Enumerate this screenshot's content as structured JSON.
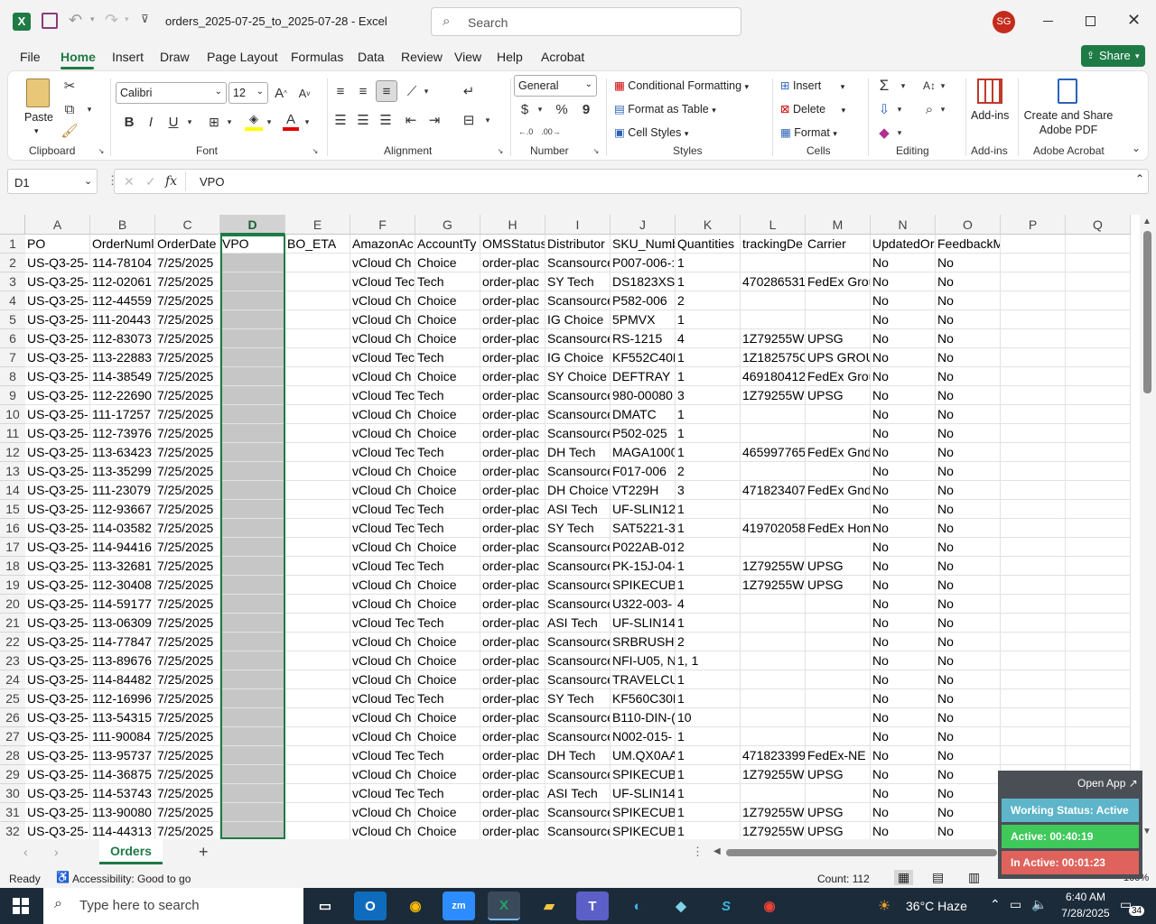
{
  "window": {
    "title": "orders_2025-07-25_to_2025-07-28  -  Excel",
    "search_placeholder": "Search",
    "user_initials": "SG"
  },
  "tabs": [
    "File",
    "Home",
    "Insert",
    "Draw",
    "Page Layout",
    "Formulas",
    "Data",
    "Review",
    "View",
    "Help",
    "Acrobat"
  ],
  "share_label": "Share",
  "ribbon": {
    "clipboard": {
      "paste": "Paste",
      "label": "Clipboard"
    },
    "font": {
      "name": "Calibri",
      "size": "12",
      "label": "Font"
    },
    "alignment": {
      "label": "Alignment"
    },
    "number": {
      "format": "General",
      "label": "Number"
    },
    "styles": {
      "conditional": "Conditional Formatting",
      "format_table": "Format as Table",
      "cell_styles": "Cell Styles",
      "label": "Styles"
    },
    "cells": {
      "insert": "Insert",
      "delete": "Delete",
      "format": "Format",
      "label": "Cells"
    },
    "editing": {
      "label": "Editing"
    },
    "addins": {
      "button": "Add-ins",
      "label": "Add-ins"
    },
    "acrobat": {
      "button_line1": "Create and Share",
      "button_line2": "Adobe PDF",
      "label": "Adobe Acrobat"
    }
  },
  "formula_bar": {
    "name_box": "D1",
    "fx": "fx",
    "value": "VPO"
  },
  "columns": [
    "A",
    "B",
    "C",
    "D",
    "E",
    "F",
    "G",
    "H",
    "I",
    "J",
    "K",
    "L",
    "M",
    "N",
    "O",
    "P",
    "Q"
  ],
  "rows": [
    [
      "PO",
      "OrderNuml",
      "OrderDate",
      "VPO",
      "BO_ETA",
      "AmazonAc",
      "AccountTy",
      "OMSStatus",
      "Distributor",
      "SKU_Numb",
      "Quantities",
      "trackingDe",
      "Carrier",
      "UpdatedOr",
      "FeedbackMessage",
      "",
      ""
    ],
    [
      "US-Q3-25-",
      "114-78104",
      "7/25/2025",
      "",
      "",
      "vCloud Ch",
      "Choice",
      "order-plac",
      "Scansource",
      "P007-006-:",
      "1",
      "",
      "",
      "No",
      "No",
      "",
      ""
    ],
    [
      "US-Q3-25-",
      "112-02061",
      "7/25/2025",
      "",
      "",
      "vCloud Tec",
      "Tech",
      "order-plac",
      "SY Tech",
      "DS1823XS+",
      "1",
      "470286531",
      "FedEx Grou",
      "No",
      "No",
      "",
      ""
    ],
    [
      "US-Q3-25-",
      "112-44559",
      "7/25/2025",
      "",
      "",
      "vCloud Ch",
      "Choice",
      "order-plac",
      "Scansource",
      "P582-006",
      "2",
      "",
      "",
      "No",
      "No",
      "",
      ""
    ],
    [
      "US-Q3-25-",
      "111-20443",
      "7/25/2025",
      "",
      "",
      "vCloud Ch",
      "Choice",
      "order-plac",
      "IG Choice",
      "5PMVX",
      "1",
      "",
      "",
      "No",
      "No",
      "",
      ""
    ],
    [
      "US-Q3-25-",
      "112-83073",
      "7/25/2025",
      "",
      "",
      "vCloud Ch",
      "Choice",
      "order-plac",
      "Scansource",
      "RS-1215",
      "4",
      "1Z79255W",
      "UPSG",
      "No",
      "No",
      "",
      ""
    ],
    [
      "US-Q3-25-",
      "113-22883",
      "7/25/2025",
      "",
      "",
      "vCloud Tec",
      "Tech",
      "order-plac",
      "IG Choice",
      "KF552C40E",
      "1",
      "1Z182575C",
      "UPS GROU",
      "No",
      "No",
      "",
      ""
    ],
    [
      "US-Q3-25-",
      "114-38549",
      "7/25/2025",
      "",
      "",
      "vCloud Ch",
      "Choice",
      "order-plac",
      "SY Choice",
      "DEFTRAY",
      "1",
      "469180412",
      "FedEx Grou",
      "No",
      "No",
      "",
      ""
    ],
    [
      "US-Q3-25-",
      "112-22690",
      "7/25/2025",
      "",
      "",
      "vCloud Tec",
      "Tech",
      "order-plac",
      "Scansource",
      "980-00080",
      "3",
      "1Z79255W",
      "UPSG",
      "No",
      "No",
      "",
      ""
    ],
    [
      "US-Q3-25-",
      "111-17257",
      "7/25/2025",
      "",
      "",
      "vCloud Ch",
      "Choice",
      "order-plac",
      "Scansource",
      "DMATC",
      "1",
      "",
      "",
      "No",
      "No",
      "",
      ""
    ],
    [
      "US-Q3-25-",
      "112-73976",
      "7/25/2025",
      "",
      "",
      "vCloud Ch",
      "Choice",
      "order-plac",
      "Scansource",
      "P502-025",
      "1",
      "",
      "",
      "No",
      "No",
      "",
      ""
    ],
    [
      "US-Q3-25-",
      "113-63423",
      "7/25/2025",
      "",
      "",
      "vCloud Tec",
      "Tech",
      "order-plac",
      "DH Tech",
      "MAGA1000",
      "1",
      "465997765",
      "FedEx Gnd",
      "No",
      "No",
      "",
      ""
    ],
    [
      "US-Q3-25-",
      "113-35299",
      "7/25/2025",
      "",
      "",
      "vCloud Ch",
      "Choice",
      "order-plac",
      "Scansource",
      "F017-006",
      "2",
      "",
      "",
      "No",
      "No",
      "",
      ""
    ],
    [
      "US-Q3-25-",
      "111-23079",
      "7/25/2025",
      "",
      "",
      "vCloud Ch",
      "Choice",
      "order-plac",
      "DH Choice",
      "VT229H",
      "3",
      "471823407",
      "FedEx Gnd",
      "No",
      "No",
      "",
      ""
    ],
    [
      "US-Q3-25-",
      "112-93667",
      "7/25/2025",
      "",
      "",
      "vCloud Tec",
      "Tech",
      "order-plac",
      "ASI Tech",
      "UF-SLIN12(",
      "1",
      "",
      "",
      "No",
      "No",
      "",
      ""
    ],
    [
      "US-Q3-25-",
      "114-03582",
      "7/25/2025",
      "",
      "",
      "vCloud Tec",
      "Tech",
      "order-plac",
      "SY Tech",
      "SAT5221-3",
      "1",
      "419702058",
      "FedEx Hon",
      "No",
      "No",
      "",
      ""
    ],
    [
      "US-Q3-25-",
      "114-94416",
      "7/25/2025",
      "",
      "",
      "vCloud Ch",
      "Choice",
      "order-plac",
      "Scansource",
      "P022AB-01",
      "2",
      "",
      "",
      "No",
      "No",
      "",
      ""
    ],
    [
      "US-Q3-25-",
      "113-32681",
      "7/25/2025",
      "",
      "",
      "vCloud Tec",
      "Tech",
      "order-plac",
      "Scansource",
      "PK-15J-04-",
      "1",
      "1Z79255W",
      "UPSG",
      "No",
      "No",
      "",
      ""
    ],
    [
      "US-Q3-25-",
      "112-30408",
      "7/25/2025",
      "",
      "",
      "vCloud Ch",
      "Choice",
      "order-plac",
      "Scansource",
      "SPIKECUBE",
      "1",
      "1Z79255W",
      "UPSG",
      "No",
      "No",
      "",
      ""
    ],
    [
      "US-Q3-25-",
      "114-59177",
      "7/25/2025",
      "",
      "",
      "vCloud Ch",
      "Choice",
      "order-plac",
      "Scansource",
      "U322-003-",
      "4",
      "",
      "",
      "No",
      "No",
      "",
      ""
    ],
    [
      "US-Q3-25-",
      "113-06309",
      "7/25/2025",
      "",
      "",
      "vCloud Tec",
      "Tech",
      "order-plac",
      "ASI Tech",
      "UF-SLIN14(",
      "1",
      "",
      "",
      "No",
      "No",
      "",
      ""
    ],
    [
      "US-Q3-25-",
      "114-77847",
      "7/25/2025",
      "",
      "",
      "vCloud Ch",
      "Choice",
      "order-plac",
      "Scansource",
      "SRBRUSHV",
      "2",
      "",
      "",
      "No",
      "No",
      "",
      ""
    ],
    [
      "US-Q3-25-",
      "113-89676",
      "7/25/2025",
      "",
      "",
      "vCloud Ch",
      "Choice",
      "order-plac",
      "Scansource",
      "NFI-U05, N",
      "1, 1",
      "",
      "",
      "No",
      "No",
      "",
      ""
    ],
    [
      "US-Q3-25-",
      "114-84482",
      "7/25/2025",
      "",
      "",
      "vCloud Ch",
      "Choice",
      "order-plac",
      "Scansource",
      "TRAVELCU",
      "1",
      "",
      "",
      "No",
      "No",
      "",
      ""
    ],
    [
      "US-Q3-25-",
      "112-16996",
      "7/25/2025",
      "",
      "",
      "vCloud Tec",
      "Tech",
      "order-plac",
      "SY Tech",
      "KF560C30E",
      "1",
      "",
      "",
      "No",
      "No",
      "",
      ""
    ],
    [
      "US-Q3-25-",
      "113-54315",
      "7/25/2025",
      "",
      "",
      "vCloud Ch",
      "Choice",
      "order-plac",
      "Scansource",
      "B110-DIN-(",
      "10",
      "",
      "",
      "No",
      "No",
      "",
      ""
    ],
    [
      "US-Q3-25-",
      "111-90084",
      "7/25/2025",
      "",
      "",
      "vCloud Ch",
      "Choice",
      "order-plac",
      "Scansource",
      "N002-015-",
      "1",
      "",
      "",
      "No",
      "No",
      "",
      ""
    ],
    [
      "US-Q3-25-",
      "113-95737",
      "7/25/2025",
      "",
      "",
      "vCloud Tec",
      "Tech",
      "order-plac",
      "DH Tech",
      "UM.QX0AA",
      "1",
      "471823399",
      "FedEx-NE",
      "No",
      "No",
      "",
      ""
    ],
    [
      "US-Q3-25-",
      "114-36875",
      "7/25/2025",
      "",
      "",
      "vCloud Ch",
      "Choice",
      "order-plac",
      "Scansource",
      "SPIKECUBE",
      "1",
      "1Z79255W",
      "UPSG",
      "No",
      "No",
      "",
      ""
    ],
    [
      "US-Q3-25-",
      "114-53743",
      "7/25/2025",
      "",
      "",
      "vCloud Tec",
      "Tech",
      "order-plac",
      "ASI Tech",
      "UF-SLIN14(",
      "1",
      "",
      "",
      "No",
      "No",
      "",
      ""
    ],
    [
      "US-Q3-25-",
      "113-90080",
      "7/25/2025",
      "",
      "",
      "vCloud Ch",
      "Choice",
      "order-plac",
      "Scansource",
      "SPIKECUBE",
      "1",
      "1Z79255W",
      "UPSG",
      "No",
      "No",
      "",
      ""
    ],
    [
      "US-Q3-25-",
      "114-44313",
      "7/25/2025",
      "",
      "",
      "vCloud Ch",
      "Choice",
      "order-plac",
      "Scansource",
      "SPIKECUBE",
      "1",
      "1Z79255W",
      "UPSG",
      "No",
      "No",
      "",
      ""
    ]
  ],
  "sheet_tab": "Orders",
  "status": {
    "ready": "Ready",
    "accessibility": "Accessibility: Good to go",
    "count": "Count: 112",
    "zoom": "100%"
  },
  "widget": {
    "open_app": "Open App ↗",
    "working": "Working Status: Active",
    "active": "Active: 00:40:19",
    "inactive": "In Active: 00:01:23"
  },
  "taskbar": {
    "search_placeholder": "Type here to search",
    "weather": "36°C  Haze",
    "time": "6:40 AM",
    "date": "7/28/2025",
    "notifications": "34"
  },
  "colors": {
    "excel_green": "#217346",
    "selection": "#c6c6c6",
    "share_green": "#1e7b45"
  }
}
